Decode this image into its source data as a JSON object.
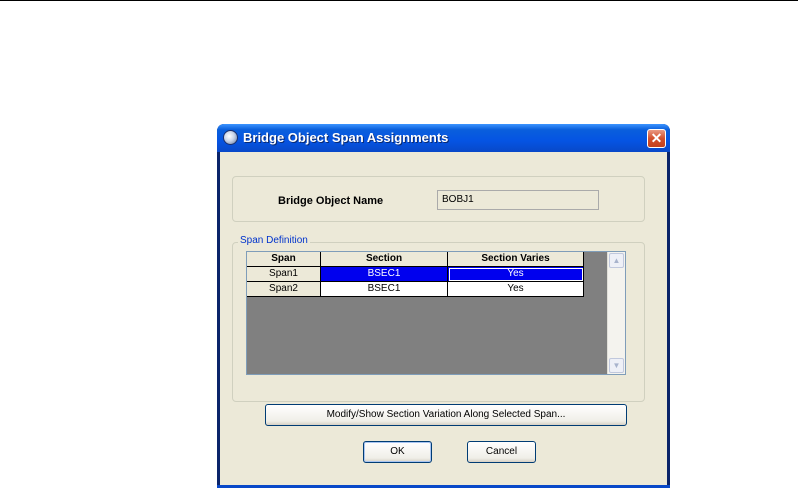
{
  "window": {
    "title": "Bridge Object Span Assignments",
    "close_glyph": "✕"
  },
  "bridge_object": {
    "label": "Bridge Object Name",
    "value": "BOBJ1"
  },
  "span_definition": {
    "legend": "Span Definition",
    "columns": [
      "Span",
      "Section",
      "Section Varies"
    ],
    "rows": [
      {
        "span": "Span1",
        "section": "BSEC1",
        "varies": "Yes",
        "selected": true
      },
      {
        "span": "Span2",
        "section": "BSEC1",
        "varies": "Yes",
        "selected": false
      }
    ]
  },
  "buttons": {
    "modify": "Modify/Show Section Variation Along Selected Span...",
    "ok": "OK",
    "cancel": "Cancel"
  },
  "scrollbar": {
    "up_glyph": "▲",
    "down_glyph": "▼"
  },
  "colors": {
    "title_bar": "#0554e3",
    "selection": "#0000ee",
    "dialog_bg": "#ece9d8",
    "grid_bg": "#808080"
  }
}
